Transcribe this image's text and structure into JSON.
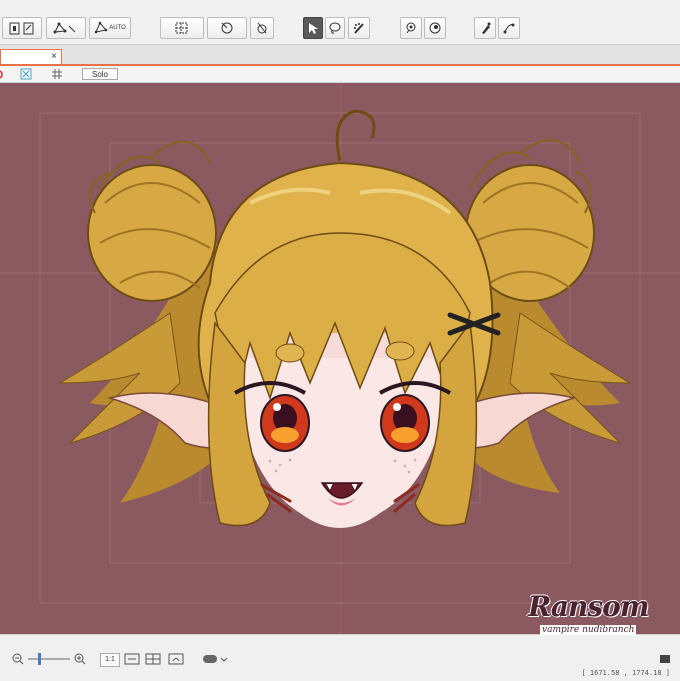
{
  "toolbar": {
    "auto_label": "AUTO"
  },
  "tabbar": {
    "close_symbol": "×"
  },
  "viewbar": {
    "solo_label": "Solo"
  },
  "bottombar": {
    "scale_label": "1:1",
    "coordinates": "[ 1671.58 , 1774.18 ]"
  },
  "watermark": {
    "title": "Ransom",
    "subtitle": "vampire nudibranch"
  },
  "colors": {
    "canvas_bg": "#8b5a60",
    "accent": "#e8734a",
    "hair": "#d8ac45",
    "eye": "#d0391c"
  }
}
